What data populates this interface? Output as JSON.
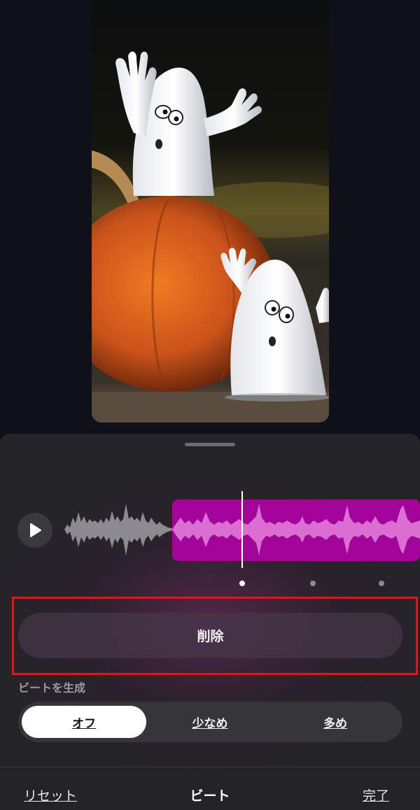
{
  "preview": {
    "image_description": "ghosts-on-pumpkin"
  },
  "player": {
    "play_icon": "play-icon",
    "playhead_position": 0.2,
    "selected_region_color": "#a3049a",
    "unselected_wave_color": "#8c8c90"
  },
  "pager": {
    "count": 3,
    "active_index": 0
  },
  "delete": {
    "label": "削除"
  },
  "beat_generation": {
    "label": "ビートを生成",
    "options": [
      "オフ",
      "少なめ",
      "多め"
    ],
    "selected": "オフ"
  },
  "bottom_bar": {
    "reset_label": "リセット",
    "title": "ビート",
    "done_label": "完了"
  },
  "colors": {
    "accent_magenta": "#a3049a",
    "highlight_red": "#e4151a"
  }
}
